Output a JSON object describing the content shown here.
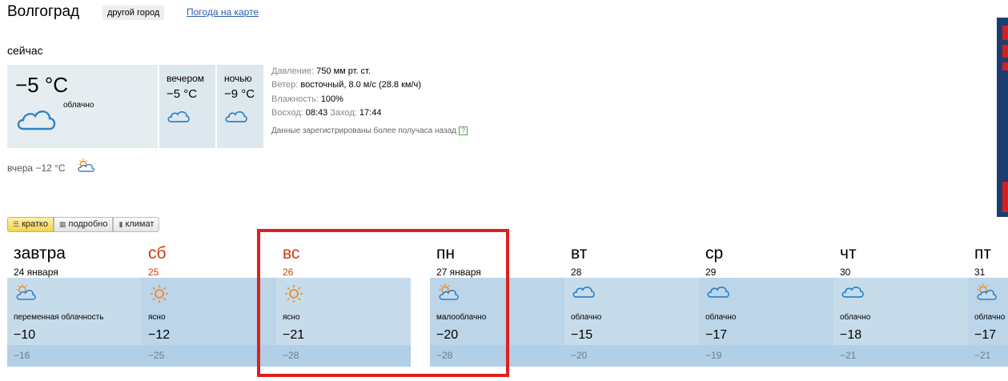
{
  "header": {
    "city": "Волгоград",
    "other_city": "другой город",
    "map_link": "Погода на карте"
  },
  "now": {
    "label": "сейчас",
    "temp": "−5 °C",
    "condition": "облачно",
    "icon": "cloud-icon",
    "evening": {
      "label": "вечером",
      "temp": "−5 °C",
      "icon": "cloud-icon"
    },
    "night": {
      "label": "ночью",
      "temp": "−9 °C",
      "icon": "cloud-icon"
    }
  },
  "details": {
    "pressure_key": "Давление:",
    "pressure_val": "750 мм рт. ст.",
    "wind_key": "Ветер:",
    "wind_val": "восточный, 8.0 м/с (28.8 км/ч)",
    "humidity_key": "Влажность:",
    "humidity_val": "100%",
    "sunrise_key": "Восход:",
    "sunrise_val": "08:43",
    "sunset_key": "Заход:",
    "sunset_val": "17:44",
    "note": "Данные зарегистрированы более получаса назад",
    "help": "?"
  },
  "yesterday": {
    "text": "вчера −12 °C",
    "icon": "partly-cloudy-icon"
  },
  "tabs": [
    {
      "label": "кратко",
      "active": true
    },
    {
      "label": "подробно",
      "active": false
    },
    {
      "label": "климат",
      "active": false
    }
  ],
  "forecast": [
    {
      "name": "завтра",
      "date": "24 января",
      "weekend": false,
      "condition": "переменная облачность",
      "high": "−10",
      "low": "−16",
      "icon": "partly-cloudy-icon"
    },
    {
      "name": "сб",
      "date": "25",
      "weekend": true,
      "condition": "ясно",
      "high": "−12",
      "low": "−25",
      "icon": "sun-icon"
    },
    {
      "name": "вс",
      "date": "26",
      "weekend": true,
      "condition": "ясно",
      "high": "−21",
      "low": "−28",
      "icon": "sun-icon"
    },
    {
      "name": "пн",
      "date": "27 января",
      "weekend": false,
      "condition": "малооблачно",
      "high": "−20",
      "low": "−28",
      "icon": "partly-cloudy-icon"
    },
    {
      "name": "вт",
      "date": "28",
      "weekend": false,
      "condition": "облачно",
      "high": "−15",
      "low": "−20",
      "icon": "cloud-icon"
    },
    {
      "name": "ср",
      "date": "29",
      "weekend": false,
      "condition": "облачно",
      "high": "−17",
      "low": "−19",
      "icon": "cloud-icon"
    },
    {
      "name": "чт",
      "date": "30",
      "weekend": false,
      "condition": "облачно",
      "high": "−18",
      "low": "−21",
      "icon": "cloud-icon"
    },
    {
      "name": "пт",
      "date": "31",
      "weekend": false,
      "condition": "облачно",
      "high": "−17",
      "low": "−21",
      "icon": "partly-cloudy-icon"
    }
  ],
  "colors": {
    "weekend": "#d03a0e",
    "highlight": "#de2020",
    "cloud": "#2f82c9",
    "sun": "#f08a24"
  }
}
